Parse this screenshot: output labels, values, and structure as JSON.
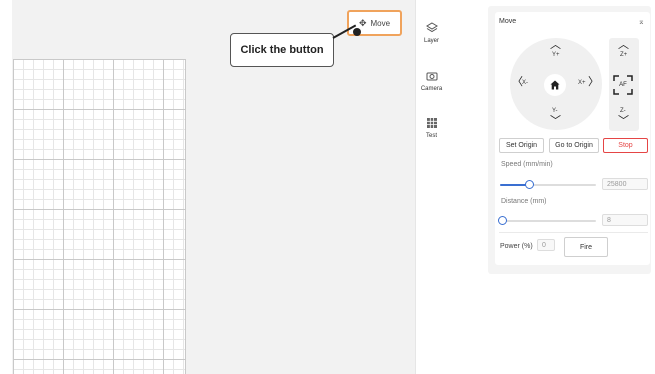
{
  "toolbar": {
    "move_label": "Move",
    "move_icon": "four-arrows-move-icon"
  },
  "annotation": {
    "callout_text": "Click the button"
  },
  "rail": {
    "items": [
      {
        "label": "Layer",
        "icon": "layers-icon"
      },
      {
        "label": "Camera",
        "icon": "camera-icon"
      },
      {
        "label": "Test",
        "icon": "grid-test-icon"
      }
    ]
  },
  "panel": {
    "title": "Move",
    "jog": {
      "y_plus": "Y+",
      "y_minus": "Y-",
      "x_minus": "X-",
      "x_plus": "X+",
      "z_plus": "Z+",
      "z_minus": "Z-",
      "af": "AF"
    },
    "buttons": {
      "set_origin": "Set Origin",
      "go_to_origin": "Go to Origin",
      "stop": "Stop"
    },
    "speed": {
      "label": "Speed (mm/min)",
      "value": "25800",
      "slider_fraction": 0.3
    },
    "distance": {
      "label": "Distance (mm)",
      "value": "8",
      "slider_fraction": 0.02
    },
    "power": {
      "label": "Power (%)",
      "value": "0",
      "fire_label": "Fire"
    }
  },
  "colors": {
    "accent": "#3a6fd1",
    "stop": "#e54545",
    "highlight": "#f0a35c"
  }
}
